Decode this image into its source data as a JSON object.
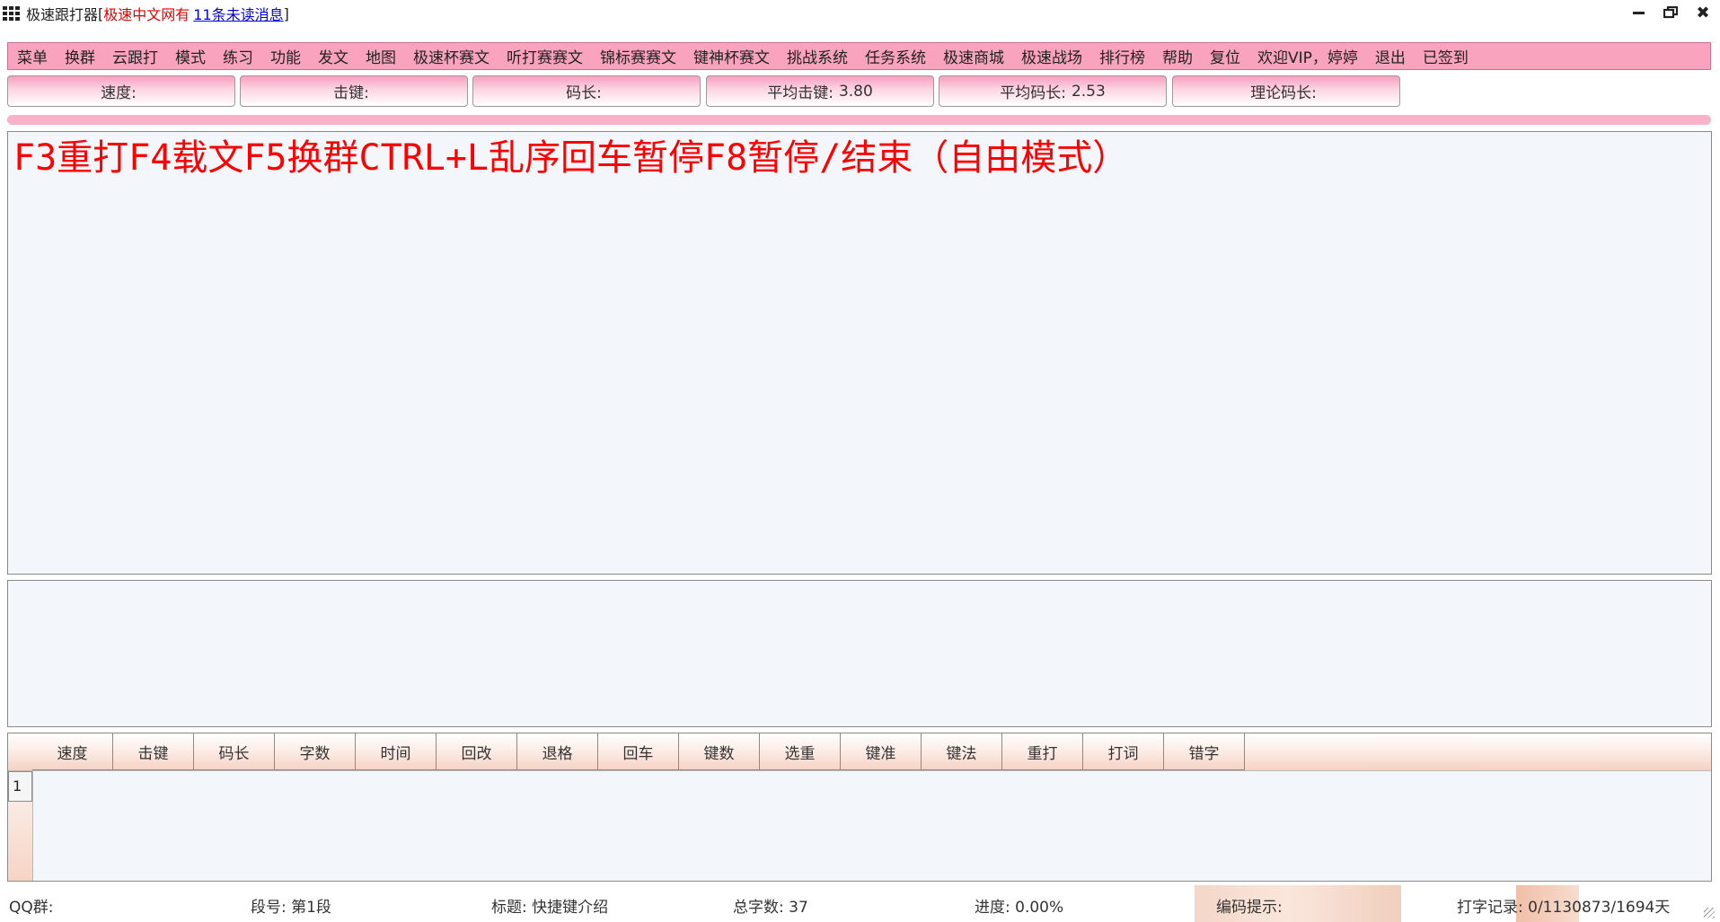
{
  "window": {
    "title": "极速跟打器",
    "title_open_bracket": "[",
    "site_name": "极速中文网有",
    "unread_link": "11条未读消息",
    "title_close_bracket": "]",
    "controls": {
      "minimize": "minimize",
      "restore": "restore",
      "close": "✖"
    }
  },
  "menu": {
    "items": [
      "菜单",
      "换群",
      "云跟打",
      "模式",
      "练习",
      "功能",
      "发文",
      "地图",
      "极速杯赛文",
      "听打赛赛文",
      "锦标赛赛文",
      "键神杯赛文",
      "挑战系统",
      "任务系统",
      "极速商城",
      "极速战场",
      "排行榜",
      "帮助",
      "复位",
      "欢迎VIP，婷婷",
      "退出",
      "已签到"
    ]
  },
  "stats": [
    {
      "label": "速度:",
      "value": ""
    },
    {
      "label": "击键:",
      "value": ""
    },
    {
      "label": "码长:",
      "value": ""
    },
    {
      "label": "平均击键:",
      "value": "3.80"
    },
    {
      "label": "平均码长:",
      "value": "2.53"
    },
    {
      "label": "理论码长:",
      "value": ""
    }
  ],
  "progress": {
    "fraction": 0.0
  },
  "article": {
    "text": "F3重打F4载文F5换群CTRL+L乱序回车暂停F8暂停/结束（自由模式）",
    "color": "#ff0000"
  },
  "table": {
    "columns": [
      "速度",
      "击键",
      "码长",
      "字数",
      "时间",
      "回改",
      "退格",
      "回车",
      "键数",
      "选重",
      "键准",
      "键法",
      "重打",
      "打词",
      "错字"
    ],
    "rows": [
      {
        "index": "1"
      }
    ]
  },
  "status": {
    "qq_group": "QQ群:",
    "segment": "段号: 第1段",
    "title": "标题: 快捷键介绍",
    "total_chars": "总字数: 37",
    "progress": "进度: 0.00%",
    "code_hint": "编码提示:",
    "record": "打字记录: 0/1130873/1694天"
  },
  "colors": {
    "menu_bg": "#f9a3bf",
    "stat_gradient_top": "#f7a0bf",
    "text_area_bg": "#f3f6fb",
    "unread_link": "#0000ee",
    "site_name": "#e00000"
  }
}
